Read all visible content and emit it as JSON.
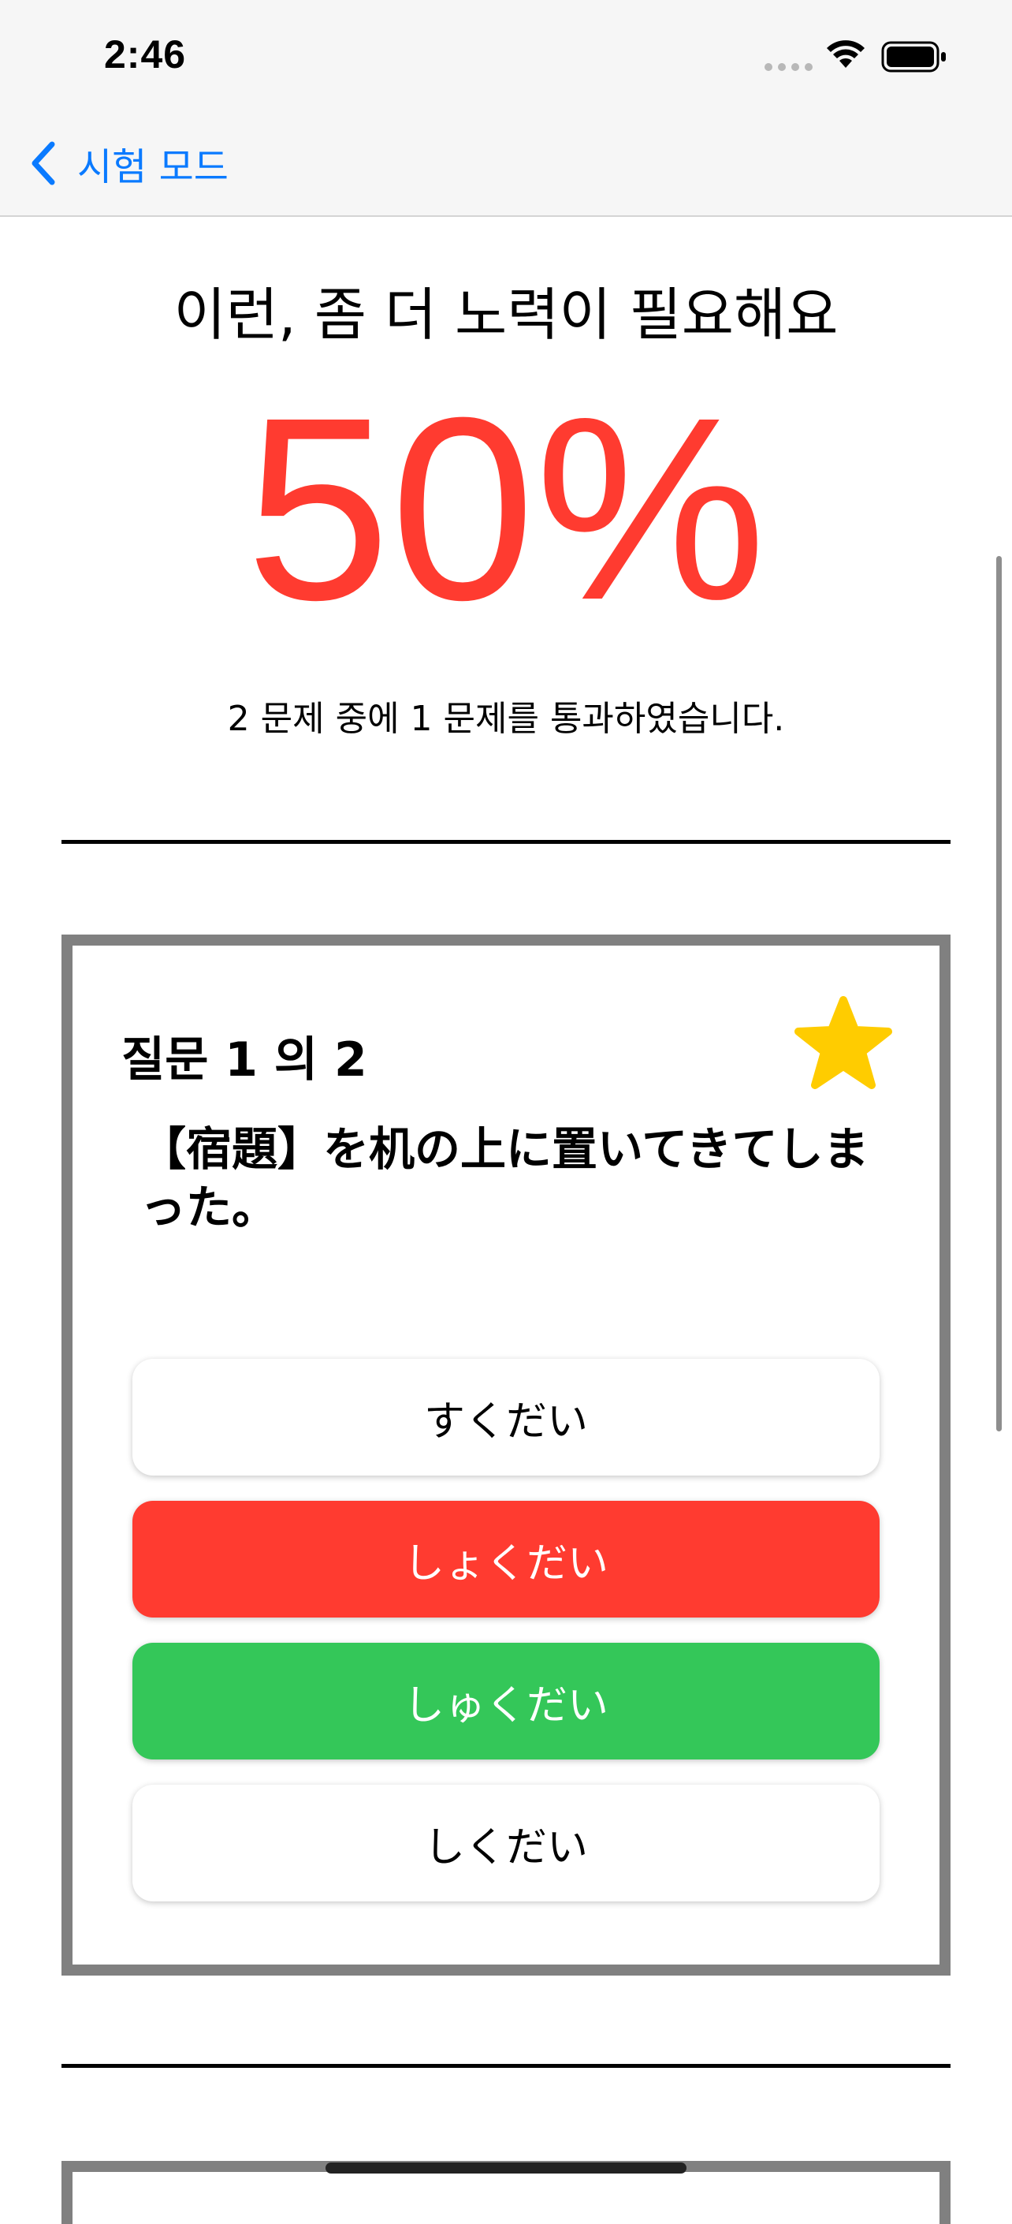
{
  "status_bar": {
    "time": "2:46"
  },
  "nav": {
    "back_label": "시험 모드"
  },
  "result": {
    "heading": "이런, 좀 더 노력이 필요해요",
    "percent": "50%",
    "summary": "2 문제 중에 1 문제를 통과하였습니다."
  },
  "question": {
    "number": "질문 1 의 2",
    "text": "【宿題】を机の上に置いてきてしまった。",
    "starred": true,
    "options": [
      {
        "label": "すくだい",
        "state": "default"
      },
      {
        "label": "しょくだい",
        "state": "wrong"
      },
      {
        "label": "しゅくだい",
        "state": "correct"
      },
      {
        "label": "しくだい",
        "state": "default"
      }
    ]
  },
  "colors": {
    "accent": "#0a7aff",
    "percent": "#ff3b30",
    "wrong": "#ff3b30",
    "correct": "#34c759",
    "star": "#ffcc00"
  }
}
